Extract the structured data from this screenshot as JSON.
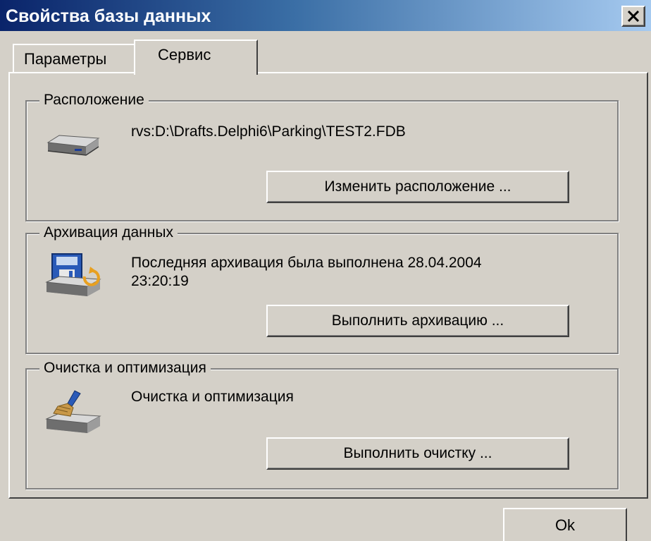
{
  "window": {
    "title": "Свойства базы данных",
    "close_label": "×"
  },
  "tabs": [
    {
      "label": "Параметры",
      "active": false
    },
    {
      "label": "Сервис",
      "active": true
    }
  ],
  "groups": {
    "location": {
      "label": "Расположение",
      "icon": "hard-drive-icon",
      "text": "rvs:D:\\Drafts.Delphi6\\Parking\\TEST2.FDB",
      "button_label": "Изменить расположение ..."
    },
    "backup": {
      "label": "Архивация данных",
      "icon": "backup-icon",
      "text_line1": "Последняя архивация была выполнена 28.04.2004",
      "text_line2": "23:20:19",
      "button_label": "Выполнить архивацию ..."
    },
    "cleanup": {
      "label": "Очистка и оптимизация",
      "icon": "broom-drive-icon",
      "text": "Очистка и оптимизация",
      "button_label": "Выполнить очистку ..."
    }
  },
  "footer": {
    "ok_label": "Ok"
  },
  "colors": {
    "face": "#d4d0c8",
    "title_start": "#0a246a",
    "title_end": "#a6caf0"
  }
}
